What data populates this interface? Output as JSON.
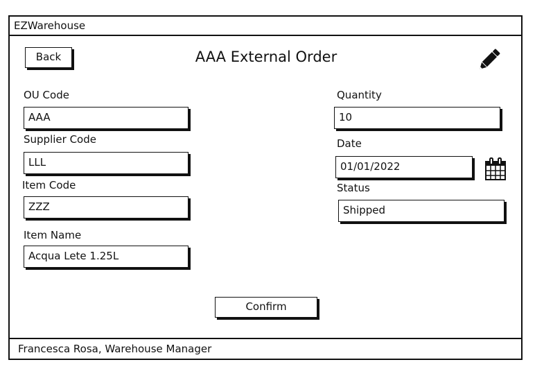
{
  "app": {
    "title": "EZWarehouse"
  },
  "header": {
    "back_label": "Back",
    "page_title": "AAA External Order",
    "edit_icon": "pencil-icon"
  },
  "form": {
    "ou_code": {
      "label": "OU Code",
      "value": "AAA"
    },
    "supplier_code": {
      "label": "Supplier Code",
      "value": "LLL"
    },
    "item_code": {
      "label": "Item Code",
      "value": "ZZZ"
    },
    "item_name": {
      "label": "Item Name",
      "value": "Acqua Lete 1.25L"
    },
    "quantity": {
      "label": "Quantity",
      "value": "10"
    },
    "date": {
      "label": "Date",
      "value": "01/01/2022",
      "icon": "calendar-icon"
    },
    "status": {
      "label": "Status",
      "value": "Shipped"
    }
  },
  "actions": {
    "confirm_label": "Confirm"
  },
  "footer": {
    "user": "Francesca Rosa, Warehouse Manager"
  }
}
